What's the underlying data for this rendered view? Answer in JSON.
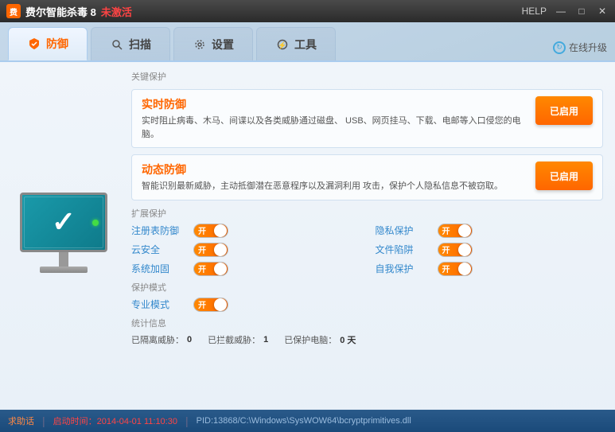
{
  "titleBar": {
    "appName": "费尔智能杀毒 8",
    "titleSuffix": "未激活",
    "helpLabel": "HELP",
    "minBtn": "—",
    "maxBtn": "□",
    "closeBtn": "✕"
  },
  "tabs": [
    {
      "id": "defense",
      "label": "防御",
      "active": true,
      "icon": "shield"
    },
    {
      "id": "scan",
      "label": "扫描",
      "active": false,
      "icon": "search"
    },
    {
      "id": "settings",
      "label": "设置",
      "active": false,
      "icon": "gear"
    },
    {
      "id": "tools",
      "label": "工具",
      "active": false,
      "icon": "lightning"
    }
  ],
  "onlineUpgrade": "在线升级",
  "sections": {
    "keyProtection": "关键保护",
    "realtimeDefense": {
      "title": "实时防御",
      "desc": "实时阻止病毒、木马、间谍以及各类威胁通过磁盘、\nUSB、网页挂马、下载、电邮等入口侵您的电脑。",
      "btnLabel": "已启用"
    },
    "dynamicDefense": {
      "title": "动态防御",
      "desc": "智能识别最新威胁，主动抵御潜在恶意程序以及漏洞利用\n攻击，保护个人隐私信息不被窃取。",
      "btnLabel": "已启用"
    },
    "expandedProtection": "扩展保护",
    "toggles": [
      {
        "label": "注册表防御",
        "enabled": true
      },
      {
        "label": "隐私保护",
        "enabled": true
      },
      {
        "label": "云安全",
        "enabled": true
      },
      {
        "label": "文件陷阱",
        "enabled": true
      },
      {
        "label": "系统加固",
        "enabled": true
      },
      {
        "label": "自我保护",
        "enabled": true
      }
    ],
    "protectionMode": "保护模式",
    "professionalMode": {
      "label": "专业模式",
      "enabled": true
    },
    "statistics": "统计信息",
    "stats": [
      {
        "label": "已隔离威胁：",
        "value": "0"
      },
      {
        "label": "已拦截威胁：",
        "value": "1"
      },
      {
        "label": "已保护电脑：",
        "value": "0 天"
      }
    ]
  },
  "statusBar": {
    "askLabel": "求助话",
    "separator": "|",
    "timeLabel": "启动时间：",
    "timeValue": "2014-04-01 11:10:30",
    "pidText": "PID:13868/C:\\Windows\\SysWOW64\\bcryptprimitives.dll"
  }
}
